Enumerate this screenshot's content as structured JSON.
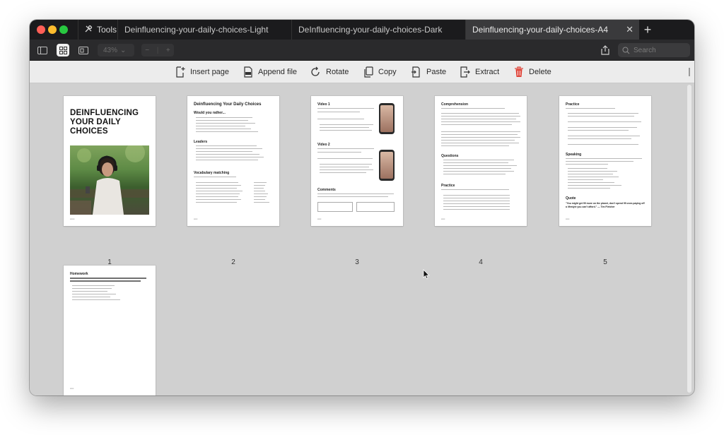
{
  "tabbar": {
    "tools_label": "Tools",
    "tabs": [
      {
        "label": "Deinfluencing-your-daily-choices-Light"
      },
      {
        "label": "DeInfluencing-your-daily-choices-Dark"
      },
      {
        "label": "Deinfluencing-your-daily-choices-A4"
      }
    ],
    "close_glyph": "✕",
    "new_tab_glyph": "+"
  },
  "toolbar": {
    "zoom": "43%",
    "search_placeholder": "Search",
    "nav_glyphs": [
      "−",
      "+"
    ]
  },
  "actions": [
    {
      "label": "Insert page",
      "icon": "insert-page-icon"
    },
    {
      "label": "Append file",
      "icon": "append-file-icon"
    },
    {
      "label": "Rotate",
      "icon": "rotate-icon"
    },
    {
      "label": "Copy",
      "icon": "copy-icon"
    },
    {
      "label": "Paste",
      "icon": "paste-icon"
    },
    {
      "label": "Extract",
      "icon": "extract-icon"
    },
    {
      "label": "Delete",
      "icon": "delete-icon"
    }
  ],
  "colors": {
    "accent_delete": "#e0453a",
    "tab_active": "#3a3a3c",
    "content_bg": "#d0d0d0"
  },
  "pages": [
    {
      "number": "1",
      "title": "DEINFLUENCING YOUR DAILY CHOICES"
    },
    {
      "number": "2",
      "title": "Deinfluencing Your Daily Choices",
      "sections": [
        "Would you rather...",
        "Leaders",
        "Vocabulary matching"
      ]
    },
    {
      "number": "3",
      "sections": [
        "Video 1",
        "Video 2",
        "Comments"
      ]
    },
    {
      "number": "4",
      "sections": [
        "Comprehension",
        "Questions",
        "Practice"
      ]
    },
    {
      "number": "5",
      "sections": [
        "Practice",
        "Speaking",
        "Quote"
      ],
      "quote": "\"You might get 99 more on the planet, don't spend 99 ones paying off a lifestyle you can't afford.\" — Tim Fletcher"
    },
    {
      "number": "",
      "sections": [
        "Homework"
      ]
    }
  ]
}
